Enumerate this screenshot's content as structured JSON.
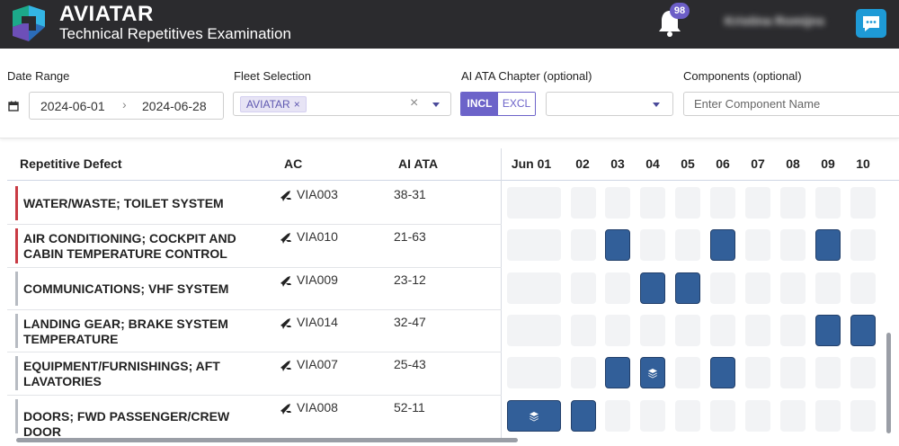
{
  "header": {
    "brand": "AVIATAR",
    "subtitle": "Technical Repetitives Examination",
    "notification_count": "98",
    "user_name": "Kristina Romijns"
  },
  "filters": {
    "date_range": {
      "label": "Date Range",
      "from": "2024-06-01",
      "separator": "›",
      "to": "2024-06-28"
    },
    "fleet": {
      "label": "Fleet Selection",
      "chip": "AVIATAR",
      "chip_remove": "×",
      "clear": "×"
    },
    "ata": {
      "label": "AI ATA Chapter (optional)",
      "incl": "INCL",
      "excl": "EXCL"
    },
    "components": {
      "label": "Components (optional)",
      "placeholder": "Enter Component Name"
    }
  },
  "table": {
    "headers": {
      "defect": "Repetitive Defect",
      "ac": "AC",
      "ata": "AI ATA"
    },
    "dates": [
      "Jun 01",
      "02",
      "03",
      "04",
      "05",
      "06",
      "07",
      "08",
      "09",
      "10"
    ],
    "rows": [
      {
        "defect": "WATER/WASTE; TOILET SYSTEM",
        "ac": "VIA003",
        "ata": "38-31",
        "severity_color": "#c93b44",
        "filled": [],
        "stacked": []
      },
      {
        "defect": "AIR CONDITIONING; COCKPIT AND CABIN TEMPERATURE CONTROL",
        "ac": "VIA010",
        "ata": "21-63",
        "severity_color": "#c93b44",
        "filled": [
          2,
          5,
          8
        ],
        "stacked": []
      },
      {
        "defect": "COMMUNICATIONS; VHF SYSTEM",
        "ac": "VIA009",
        "ata": "23-12",
        "severity_color": "#b7bbc2",
        "filled": [
          3,
          4
        ],
        "stacked": []
      },
      {
        "defect": "LANDING GEAR; BRAKE SYSTEM TEMPERATURE",
        "ac": "VIA014",
        "ata": "32-47",
        "severity_color": "#b7bbc2",
        "filled": [
          8,
          9
        ],
        "stacked": []
      },
      {
        "defect": "EQUIPMENT/FURNISHINGS; AFT LAVATORIES",
        "ac": "VIA007",
        "ata": "25-43",
        "severity_color": "#b7bbc2",
        "filled": [
          2,
          3,
          5
        ],
        "stacked": [
          3
        ]
      },
      {
        "defect": "DOORS; FWD PASSENGER/CREW DOOR",
        "ac": "VIA008",
        "ata": "52-11",
        "severity_color": "#b7bbc2",
        "filled": [
          0,
          1
        ],
        "stacked": [
          0
        ]
      }
    ]
  },
  "colors": {
    "accent": "#6c63c9",
    "filled_cell": "#325f99",
    "header_bg": "#2b2b2e",
    "chat_button": "#1e9ad6"
  }
}
